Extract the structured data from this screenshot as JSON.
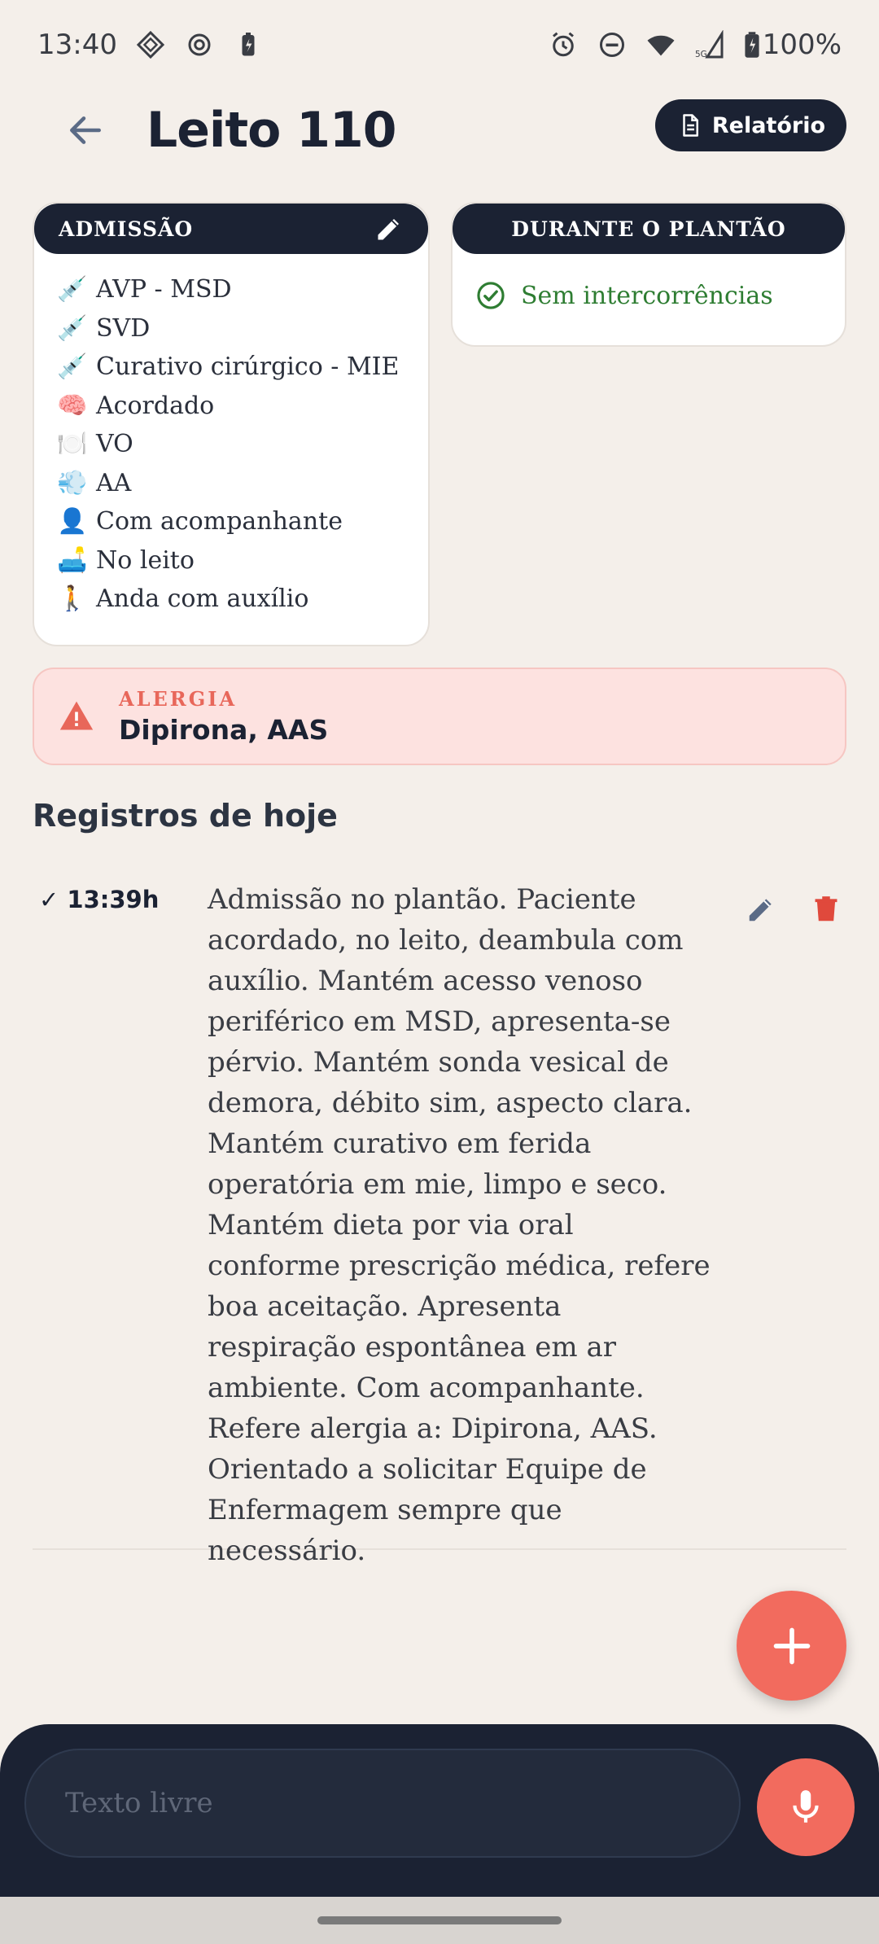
{
  "status_bar": {
    "time": "13:40",
    "battery": "100%",
    "network": "5G",
    "icons": [
      "diamond-icon",
      "settings-sync-icon",
      "battery-saver-icon",
      "alarm-icon",
      "dnd-icon",
      "wifi-icon",
      "signal-icon",
      "battery-icon"
    ]
  },
  "header": {
    "title": "Leito 110",
    "report_label": "Relatório"
  },
  "admissao": {
    "title": "ADMISSÃO",
    "items": [
      {
        "emoji": "💉",
        "label": "AVP - MSD"
      },
      {
        "emoji": "💉",
        "label": "SVD"
      },
      {
        "emoji": "💉",
        "label": "Curativo cirúrgico - MIE"
      },
      {
        "emoji": "🧠",
        "label": "Acordado"
      },
      {
        "emoji": "🍽️",
        "label": "VO"
      },
      {
        "emoji": "💨",
        "label": "AA"
      },
      {
        "emoji": "👤",
        "label": "Com acompanhante"
      },
      {
        "emoji": "🛋️",
        "label": "No leito"
      },
      {
        "emoji": "🚶",
        "label": "Anda com auxílio"
      }
    ]
  },
  "plantao": {
    "title": "DURANTE O PLANTÃO",
    "status": "Sem intercorrências"
  },
  "allergy": {
    "label": "ALERGIA",
    "value": "Dipirona, AAS"
  },
  "records": {
    "section_title": "Registros de hoje",
    "items": [
      {
        "time": "✓ 13:39h",
        "text": "Admissão no plantão. Paciente acordado, no leito, deambula com auxílio. Mantém acesso venoso periférico em MSD, apresenta-se pérvio. Mantém sonda vesical de demora, débito sim, aspecto clara. Mantém curativo em ferida operatória em mie, limpo e seco. Mantém dieta por via oral conforme prescrição médica, refere boa aceitação. Apresenta respiração espontânea em ar ambiente. Com acompanhante. Refere alergia a: Dipirona, AAS. Orientado a solicitar Equipe de Enfermagem sempre que necessário."
      }
    ]
  },
  "input": {
    "placeholder": "Texto livre"
  },
  "colors": {
    "navy": "#1b2233",
    "coral": "#f26b5e",
    "background": "#f4efea",
    "success": "#2e7d32",
    "allergy_bg": "#fde2e0"
  }
}
